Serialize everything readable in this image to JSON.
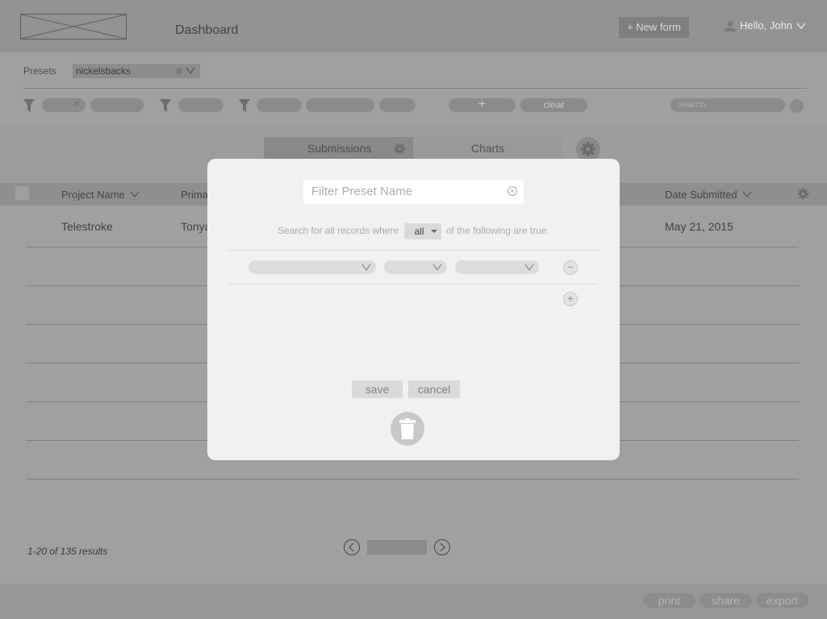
{
  "header": {
    "title": "Dashboard",
    "new_form_label": "+ New form",
    "greeting": "Hello, John",
    "logo_icon": "logo-placeholder-icon",
    "user_icon": "user-icon"
  },
  "presets": {
    "label": "Presets",
    "selected": "nickelsbacks"
  },
  "filters": {
    "add_label": "+",
    "clear_label": "clear",
    "search_placeholder": "search"
  },
  "tabs": [
    {
      "label": "Submissions",
      "active": true
    },
    {
      "label": "Charts",
      "active": false
    }
  ],
  "table": {
    "columns": [
      "Project Name",
      "Primar",
      "Date Submitted"
    ],
    "rows": [
      {
        "project": "Telestroke",
        "primary": "Tonya",
        "date": "May 21, 2015"
      }
    ]
  },
  "pagination": {
    "results_text": "1-20 of 135 results"
  },
  "footer": {
    "print_label": "print",
    "share_label": "share",
    "export_label": "export"
  },
  "modal": {
    "preset_name_placeholder": "Filter Preset Name",
    "sentence_before": "Search for all records where",
    "match_value": "all",
    "sentence_after": "of the following are true.",
    "remove_label": "−",
    "add_label": "+",
    "save_label": "save",
    "cancel_label": "cancel"
  },
  "colors": {
    "overlay": "#a0a0a0",
    "modal_bg": "#f1f1f1"
  }
}
